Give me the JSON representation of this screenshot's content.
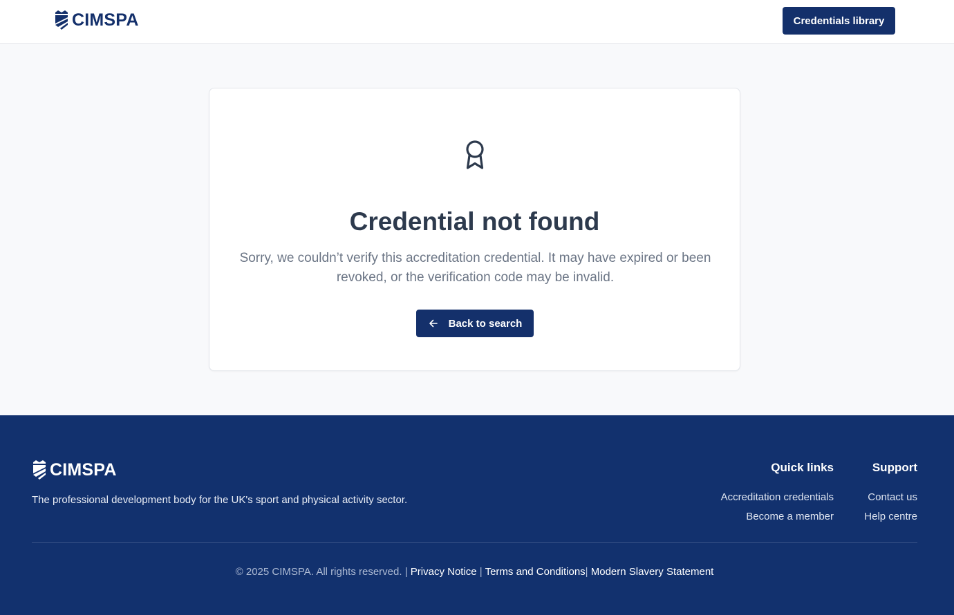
{
  "header": {
    "logo_text": "CIMSPA",
    "library_button": "Credentials library"
  },
  "card": {
    "icon": "award-ribbon-icon",
    "title": "Credential not found",
    "message": "Sorry, we couldn’t verify this accreditation credential. It may have expired or been revoked, or the verification code may be invalid.",
    "back_button": "Back to search"
  },
  "footer": {
    "logo_text": "CIMSPA",
    "tagline": "The professional development body for the UK's sport and physical activity sector.",
    "quick_links": {
      "heading": "Quick links",
      "items": [
        "Accreditation credentials",
        "Become a member"
      ]
    },
    "support": {
      "heading": "Support",
      "items": [
        "Contact us",
        "Help centre"
      ]
    },
    "legal": {
      "copyright": "© 2025 CIMSPA. All rights reserved. | ",
      "privacy": "Privacy Notice",
      "sep1": " | ",
      "terms": "Terms and Conditions",
      "sep2": "| ",
      "slavery": "Modern Slavery Statement"
    }
  },
  "colors": {
    "brand_navy": "#14306b",
    "footer_bg": "#12316e",
    "page_bg": "#f8f9fb"
  }
}
